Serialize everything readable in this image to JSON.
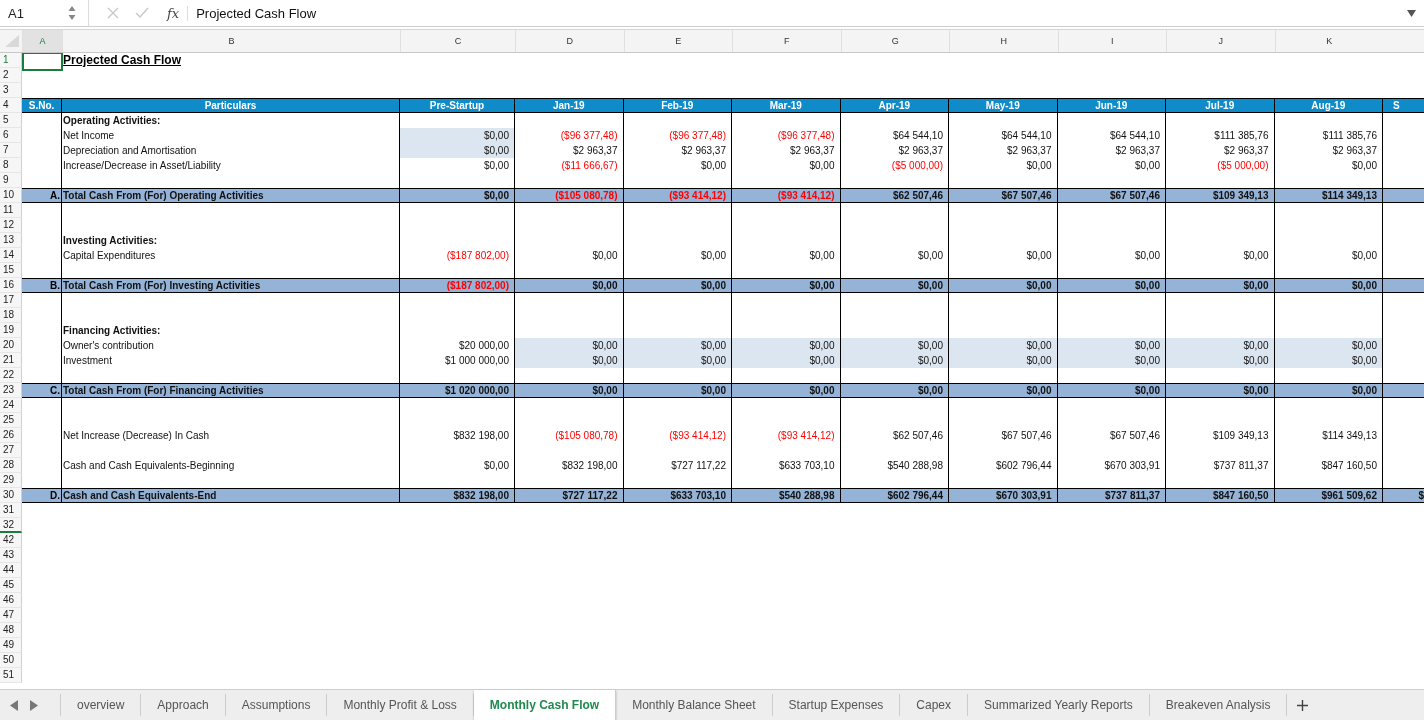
{
  "formula_bar": {
    "cell_ref": "A1",
    "function_label": "fx",
    "formula": "Projected Cash Flow"
  },
  "columns": [
    "A",
    "B",
    "C",
    "D",
    "E",
    "F",
    "G",
    "H",
    "I",
    "J",
    "K"
  ],
  "title": {
    "row": "1",
    "text": "Projected Cash Flow"
  },
  "blank_rows": [
    "2",
    "3"
  ],
  "header": {
    "row": "4",
    "cells": [
      "S.No.",
      "Particulars",
      "Pre-Startup",
      "Jan-19",
      "Feb-19",
      "Mar-19",
      "Apr-19",
      "May-19",
      "Jun-19",
      "Jul-19",
      "Aug-19",
      "S"
    ]
  },
  "rows": [
    {
      "row": "5",
      "kind": "heading",
      "label": "Operating Activities:"
    },
    {
      "row": "6",
      "kind": "item",
      "label": "Net Income",
      "cells": [
        {
          "text": "$0,00",
          "negative": false,
          "input": true
        },
        {
          "text": "($96 377,48)",
          "negative": true,
          "input": false
        },
        {
          "text": "($96 377,48)",
          "negative": true,
          "input": false
        },
        {
          "text": "($96 377,48)",
          "negative": true,
          "input": false
        },
        {
          "text": "$64 544,10",
          "negative": false,
          "input": false
        },
        {
          "text": "$64 544,10",
          "negative": false,
          "input": false
        },
        {
          "text": "$64 544,10",
          "negative": false,
          "input": false
        },
        {
          "text": "$111 385,76",
          "negative": false,
          "input": false
        },
        {
          "text": "$111 385,76",
          "negative": false,
          "input": false
        }
      ]
    },
    {
      "row": "7",
      "kind": "item",
      "label": "Depreciation and Amortisation",
      "cells": [
        {
          "text": "$0,00",
          "negative": false,
          "input": true
        },
        {
          "text": "$2 963,37",
          "negative": false,
          "input": false
        },
        {
          "text": "$2 963,37",
          "negative": false,
          "input": false
        },
        {
          "text": "$2 963,37",
          "negative": false,
          "input": false
        },
        {
          "text": "$2 963,37",
          "negative": false,
          "input": false
        },
        {
          "text": "$2 963,37",
          "negative": false,
          "input": false
        },
        {
          "text": "$2 963,37",
          "negative": false,
          "input": false
        },
        {
          "text": "$2 963,37",
          "negative": false,
          "input": false
        },
        {
          "text": "$2 963,37",
          "negative": false,
          "input": false
        }
      ]
    },
    {
      "row": "8",
      "kind": "item",
      "label": "Increase/Decrease in Asset/Liability",
      "cells": [
        {
          "text": "$0,00",
          "negative": false,
          "input": false
        },
        {
          "text": "($11 666,67)",
          "negative": true,
          "input": false
        },
        {
          "text": "$0,00",
          "negative": false,
          "input": false
        },
        {
          "text": "$0,00",
          "negative": false,
          "input": false
        },
        {
          "text": "($5 000,00)",
          "negative": true,
          "input": false
        },
        {
          "text": "$0,00",
          "negative": false,
          "input": false
        },
        {
          "text": "$0,00",
          "negative": false,
          "input": false
        },
        {
          "text": "($5 000,00)",
          "negative": true,
          "input": false
        },
        {
          "text": "$0,00",
          "negative": false,
          "input": false
        }
      ]
    },
    {
      "row": "9",
      "kind": "spacer"
    },
    {
      "row": "10",
      "kind": "total",
      "sno": "A.",
      "label": "Total Cash From (For) Operating Activities",
      "cells": [
        {
          "text": "$0,00",
          "negative": false,
          "input": false
        },
        {
          "text": "($105 080,78)",
          "negative": true,
          "input": false
        },
        {
          "text": "($93 414,12)",
          "negative": true,
          "input": false
        },
        {
          "text": "($93 414,12)",
          "negative": true,
          "input": false
        },
        {
          "text": "$62 507,46",
          "negative": false,
          "input": false
        },
        {
          "text": "$67 507,46",
          "negative": false,
          "input": false
        },
        {
          "text": "$67 507,46",
          "negative": false,
          "input": false
        },
        {
          "text": "$109 349,13",
          "negative": false,
          "input": false
        },
        {
          "text": "$114 349,13",
          "negative": false,
          "input": false
        }
      ]
    },
    {
      "row": "11",
      "kind": "spacer"
    },
    {
      "row": "12",
      "kind": "spacer"
    },
    {
      "row": "13",
      "kind": "heading",
      "label": "Investing Activities:"
    },
    {
      "row": "14",
      "kind": "item",
      "label": "Capital Expenditures",
      "cells": [
        {
          "text": "($187 802,00)",
          "negative": true,
          "input": false
        },
        {
          "text": "$0,00",
          "negative": false,
          "input": false
        },
        {
          "text": "$0,00",
          "negative": false,
          "input": false
        },
        {
          "text": "$0,00",
          "negative": false,
          "input": false
        },
        {
          "text": "$0,00",
          "negative": false,
          "input": false
        },
        {
          "text": "$0,00",
          "negative": false,
          "input": false
        },
        {
          "text": "$0,00",
          "negative": false,
          "input": false
        },
        {
          "text": "$0,00",
          "negative": false,
          "input": false
        },
        {
          "text": "$0,00",
          "negative": false,
          "input": false
        }
      ]
    },
    {
      "row": "15",
      "kind": "spacer"
    },
    {
      "row": "16",
      "kind": "total",
      "sno": "B.",
      "label": "Total Cash From (For) Investing Activities",
      "cells": [
        {
          "text": "($187 802,00)",
          "negative": true,
          "input": false
        },
        {
          "text": "$0,00",
          "negative": false,
          "input": false
        },
        {
          "text": "$0,00",
          "negative": false,
          "input": false
        },
        {
          "text": "$0,00",
          "negative": false,
          "input": false
        },
        {
          "text": "$0,00",
          "negative": false,
          "input": false
        },
        {
          "text": "$0,00",
          "negative": false,
          "input": false
        },
        {
          "text": "$0,00",
          "negative": false,
          "input": false
        },
        {
          "text": "$0,00",
          "negative": false,
          "input": false
        },
        {
          "text": "$0,00",
          "negative": false,
          "input": false
        }
      ]
    },
    {
      "row": "17",
      "kind": "spacer"
    },
    {
      "row": "18",
      "kind": "spacer"
    },
    {
      "row": "19",
      "kind": "heading",
      "label": "Financing Activities:"
    },
    {
      "row": "20",
      "kind": "item",
      "label": "Owner's contribution",
      "cells": [
        {
          "text": "$20 000,00",
          "negative": false,
          "input": false
        },
        {
          "text": "$0,00",
          "negative": false,
          "input": true
        },
        {
          "text": "$0,00",
          "negative": false,
          "input": true
        },
        {
          "text": "$0,00",
          "negative": false,
          "input": true
        },
        {
          "text": "$0,00",
          "negative": false,
          "input": true
        },
        {
          "text": "$0,00",
          "negative": false,
          "input": true
        },
        {
          "text": "$0,00",
          "negative": false,
          "input": true
        },
        {
          "text": "$0,00",
          "negative": false,
          "input": true
        },
        {
          "text": "$0,00",
          "negative": false,
          "input": true
        }
      ]
    },
    {
      "row": "21",
      "kind": "item",
      "label": "Investment",
      "cells": [
        {
          "text": "$1 000 000,00",
          "negative": false,
          "input": false
        },
        {
          "text": "$0,00",
          "negative": false,
          "input": true
        },
        {
          "text": "$0,00",
          "negative": false,
          "input": true
        },
        {
          "text": "$0,00",
          "negative": false,
          "input": true
        },
        {
          "text": "$0,00",
          "negative": false,
          "input": true
        },
        {
          "text": "$0,00",
          "negative": false,
          "input": true
        },
        {
          "text": "$0,00",
          "negative": false,
          "input": true
        },
        {
          "text": "$0,00",
          "negative": false,
          "input": true
        },
        {
          "text": "$0,00",
          "negative": false,
          "input": true
        }
      ]
    },
    {
      "row": "22",
      "kind": "spacer"
    },
    {
      "row": "23",
      "kind": "total",
      "sno": "C.",
      "label": "Total Cash From (For) Financing Activities",
      "cells": [
        {
          "text": "$1 020 000,00",
          "negative": false,
          "input": false
        },
        {
          "text": "$0,00",
          "negative": false,
          "input": false
        },
        {
          "text": "$0,00",
          "negative": false,
          "input": false
        },
        {
          "text": "$0,00",
          "negative": false,
          "input": false
        },
        {
          "text": "$0,00",
          "negative": false,
          "input": false
        },
        {
          "text": "$0,00",
          "negative": false,
          "input": false
        },
        {
          "text": "$0,00",
          "negative": false,
          "input": false
        },
        {
          "text": "$0,00",
          "negative": false,
          "input": false
        },
        {
          "text": "$0,00",
          "negative": false,
          "input": false
        }
      ]
    },
    {
      "row": "24",
      "kind": "spacer"
    },
    {
      "row": "25",
      "kind": "spacer"
    },
    {
      "row": "26",
      "kind": "item",
      "label": "Net Increase (Decrease) In Cash",
      "cells": [
        {
          "text": "$832 198,00",
          "negative": false,
          "input": false
        },
        {
          "text": "($105 080,78)",
          "negative": true,
          "input": false
        },
        {
          "text": "($93 414,12)",
          "negative": true,
          "input": false
        },
        {
          "text": "($93 414,12)",
          "negative": true,
          "input": false
        },
        {
          "text": "$62 507,46",
          "negative": false,
          "input": false
        },
        {
          "text": "$67 507,46",
          "negative": false,
          "input": false
        },
        {
          "text": "$67 507,46",
          "negative": false,
          "input": false
        },
        {
          "text": "$109 349,13",
          "negative": false,
          "input": false
        },
        {
          "text": "$114 349,13",
          "negative": false,
          "input": false
        }
      ]
    },
    {
      "row": "27",
      "kind": "spacer"
    },
    {
      "row": "28",
      "kind": "item",
      "label": "Cash and Cash Equivalents-Beginning",
      "cells": [
        {
          "text": "$0,00",
          "negative": false,
          "input": false
        },
        {
          "text": "$832 198,00",
          "negative": false,
          "input": false
        },
        {
          "text": "$727 117,22",
          "negative": false,
          "input": false
        },
        {
          "text": "$633 703,10",
          "negative": false,
          "input": false
        },
        {
          "text": "$540 288,98",
          "negative": false,
          "input": false
        },
        {
          "text": "$602 796,44",
          "negative": false,
          "input": false
        },
        {
          "text": "$670 303,91",
          "negative": false,
          "input": false
        },
        {
          "text": "$737 811,37",
          "negative": false,
          "input": false
        },
        {
          "text": "$847 160,50",
          "negative": false,
          "input": false
        }
      ]
    },
    {
      "row": "29",
      "kind": "spacer"
    },
    {
      "row": "30",
      "kind": "total",
      "sno": "D.",
      "label": "Cash and Cash Equivalents-End",
      "cells": [
        {
          "text": "$832 198,00",
          "negative": false,
          "input": false
        },
        {
          "text": "$727 117,22",
          "negative": false,
          "input": false
        },
        {
          "text": "$633 703,10",
          "negative": false,
          "input": false
        },
        {
          "text": "$540 288,98",
          "negative": false,
          "input": false
        },
        {
          "text": "$602 796,44",
          "negative": false,
          "input": false
        },
        {
          "text": "$670 303,91",
          "negative": false,
          "input": false
        },
        {
          "text": "$737 811,37",
          "negative": false,
          "input": false
        },
        {
          "text": "$847 160,50",
          "negative": false,
          "input": false
        },
        {
          "text": "$961 509,62",
          "negative": false,
          "input": false
        },
        {
          "text": "$",
          "negative": false,
          "input": false
        }
      ]
    }
  ],
  "empty_rows": [
    "31",
    "32",
    "42",
    "43",
    "44",
    "45",
    "46",
    "47",
    "48",
    "49",
    "50",
    "51"
  ],
  "sheet_tabs": [
    {
      "label": "overview",
      "selected": false
    },
    {
      "label": "Approach",
      "selected": false
    },
    {
      "label": "Assumptions",
      "selected": false
    },
    {
      "label": "Monthly Profit & Loss",
      "selected": false
    },
    {
      "label": "Monthly Cash Flow",
      "selected": true
    },
    {
      "label": "Monthly Balance Sheet",
      "selected": false
    },
    {
      "label": "Startup Expenses",
      "selected": false
    },
    {
      "label": "Capex",
      "selected": false
    },
    {
      "label": "Summarized Yearly Reports",
      "selected": false
    },
    {
      "label": "Breakeven Analysis",
      "selected": false
    }
  ]
}
